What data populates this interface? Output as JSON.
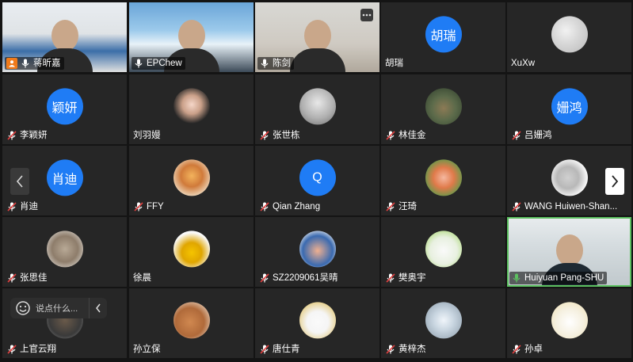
{
  "participants": [
    {
      "name": "蒋昕嘉",
      "type": "video",
      "mic": "on",
      "badge": "person",
      "scene": "office"
    },
    {
      "name": "EPChew",
      "type": "video",
      "mic": "on",
      "scene": "beach"
    },
    {
      "name": "陈剑",
      "type": "video",
      "mic": "on",
      "scene": "room",
      "has_more_button": true
    },
    {
      "name": "胡瑞",
      "type": "avatar-text",
      "initials": "胡瑞",
      "mic": "none"
    },
    {
      "name": "XuXw",
      "type": "avatar-image",
      "mic": "none"
    },
    {
      "name": "李颖妍",
      "type": "avatar-text",
      "initials": "颖妍",
      "mic": "muted"
    },
    {
      "name": "刘羽嫚",
      "type": "avatar-image",
      "mic": "none"
    },
    {
      "name": "张世栋",
      "type": "avatar-image",
      "mic": "muted"
    },
    {
      "name": "林佳金",
      "type": "avatar-image",
      "mic": "muted"
    },
    {
      "name": "吕姗鸿",
      "type": "avatar-text",
      "initials": "姗鸿",
      "mic": "muted"
    },
    {
      "name": "肖迪",
      "type": "avatar-text",
      "initials": "肖迪",
      "mic": "muted"
    },
    {
      "name": "FFY",
      "type": "avatar-image",
      "mic": "muted"
    },
    {
      "name": "Qian Zhang",
      "type": "avatar-text",
      "initials": "Q",
      "mic": "muted"
    },
    {
      "name": "汪琦",
      "type": "avatar-image",
      "mic": "muted"
    },
    {
      "name": "WANG Huiwen-Shan...",
      "type": "avatar-image",
      "mic": "muted"
    },
    {
      "name": "张思佳",
      "type": "avatar-image",
      "mic": "muted"
    },
    {
      "name": "徐晨",
      "type": "avatar-image",
      "mic": "none"
    },
    {
      "name": "SZ2209061吴晴",
      "type": "avatar-image",
      "mic": "muted"
    },
    {
      "name": "樊奥宇",
      "type": "avatar-image",
      "mic": "muted"
    },
    {
      "name": "Huiyuan Pang-SHU",
      "type": "video",
      "mic": "speaking",
      "scene": "lab",
      "active_speaker": true
    },
    {
      "name": "上官云翔",
      "type": "avatar-image",
      "mic": "muted"
    },
    {
      "name": "孙立保",
      "type": "avatar-image",
      "mic": "none"
    },
    {
      "name": "唐仕青",
      "type": "avatar-image",
      "mic": "muted"
    },
    {
      "name": "黄梓杰",
      "type": "avatar-image",
      "mic": "muted"
    },
    {
      "name": "孙卓",
      "type": "avatar-image",
      "mic": "muted"
    }
  ],
  "chat": {
    "placeholder": "说点什么..."
  },
  "colors": {
    "background": "#141414",
    "tile": "#262626",
    "avatar_blue": "#1f7cf5",
    "muted_red": "#e04040",
    "speaker_green": "#5cc060",
    "badge_orange": "#f07a1a"
  }
}
